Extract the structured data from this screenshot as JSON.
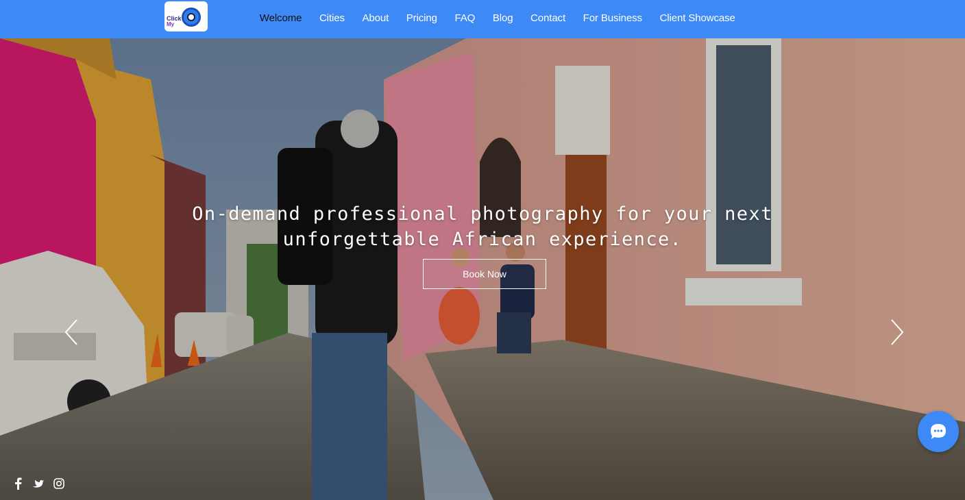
{
  "logo": {
    "text_line1": "Click",
    "text_line2": "My",
    "icon": "camera-logo-icon"
  },
  "nav": {
    "items": [
      {
        "label": "Welcome",
        "active": true
      },
      {
        "label": "Cities",
        "active": false
      },
      {
        "label": "About",
        "active": false
      },
      {
        "label": "Pricing",
        "active": false
      },
      {
        "label": "FAQ",
        "active": false
      },
      {
        "label": "Blog",
        "active": false
      },
      {
        "label": "Contact",
        "active": false
      },
      {
        "label": "For Business",
        "active": false
      },
      {
        "label": "Client Showcase",
        "active": false
      }
    ]
  },
  "hero": {
    "headline": "On-demand professional photography for your next\nunforgettable African experience.",
    "cta_label": "Book Now",
    "prev_icon": "chevron-left-icon",
    "next_icon": "chevron-right-icon"
  },
  "social": {
    "icons": [
      "facebook-icon",
      "twitter-icon",
      "instagram-icon"
    ]
  },
  "chat": {
    "icon": "chat-bubble-icon"
  },
  "colors": {
    "header_bg": "#3d8af7",
    "nav_text": "#ffffff",
    "nav_active_text": "#111111",
    "chat_button": "#3d8af7"
  }
}
